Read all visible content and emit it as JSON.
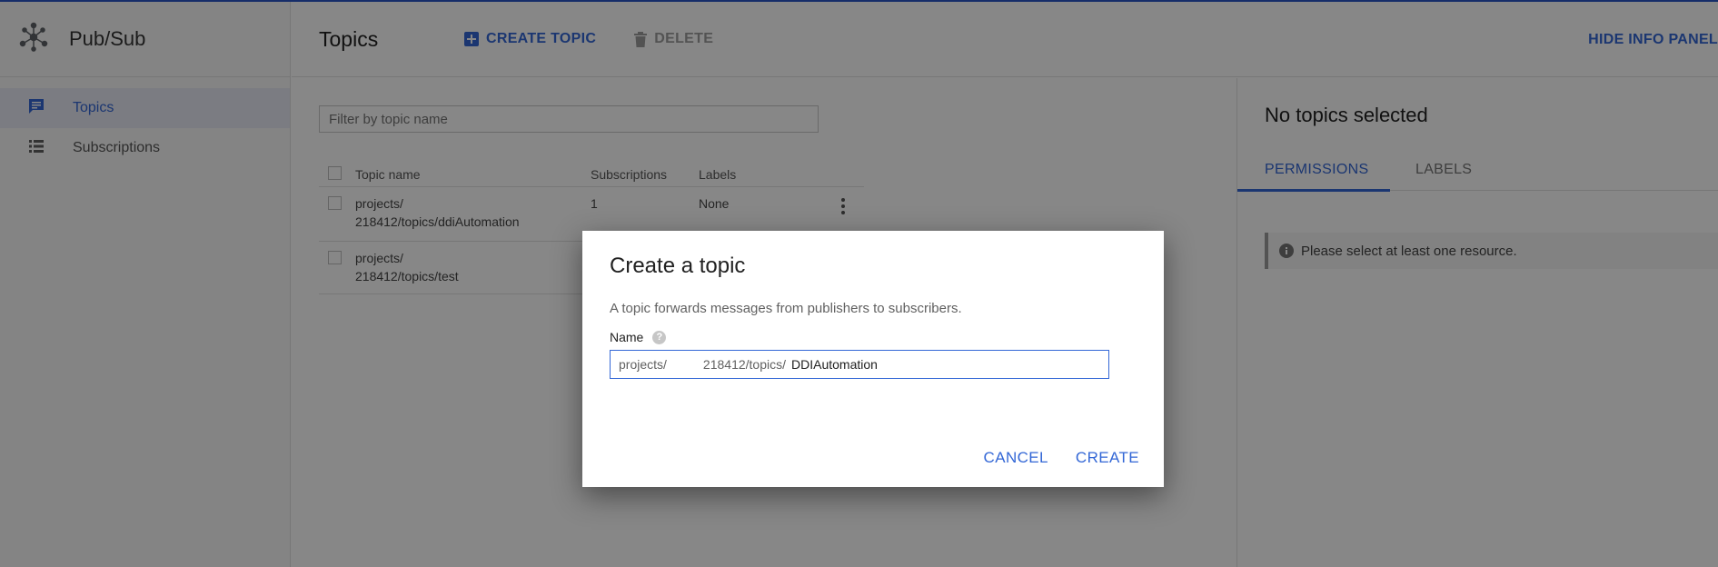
{
  "app": {
    "name": "Pub/Sub",
    "accent_color": "#3367d6"
  },
  "sidebar": {
    "items": [
      {
        "label": "Topics",
        "icon": "chat-bubble-icon",
        "active": true
      },
      {
        "label": "Subscriptions",
        "icon": "list-icon",
        "active": false
      }
    ]
  },
  "header": {
    "title": "Topics",
    "create_label": "CREATE TOPIC",
    "delete_label": "DELETE",
    "hide_panel_label": "HIDE INFO PANEL"
  },
  "filter": {
    "placeholder": "Filter by topic name"
  },
  "table": {
    "columns": [
      "Topic name",
      "Subscriptions",
      "Labels"
    ],
    "rows": [
      {
        "name_line1": "projects/",
        "name_line2": "218412/topics/ddiAutomation",
        "subscriptions": "1",
        "labels": "None"
      },
      {
        "name_line1": "projects/",
        "name_line2": "218412/topics/test",
        "subscriptions": "",
        "labels": ""
      }
    ]
  },
  "info_panel": {
    "title": "No topics selected",
    "tabs": [
      "PERMISSIONS",
      "LABELS"
    ],
    "notice": "Please select at least one resource."
  },
  "dialog": {
    "title": "Create a topic",
    "description": "A topic forwards messages from publishers to subscribers.",
    "name_label": "Name",
    "prefix_start": "projects/",
    "prefix_end": "218412/topics/",
    "name_value": "DDIAutomation",
    "cancel_label": "CANCEL",
    "create_label": "CREATE"
  }
}
